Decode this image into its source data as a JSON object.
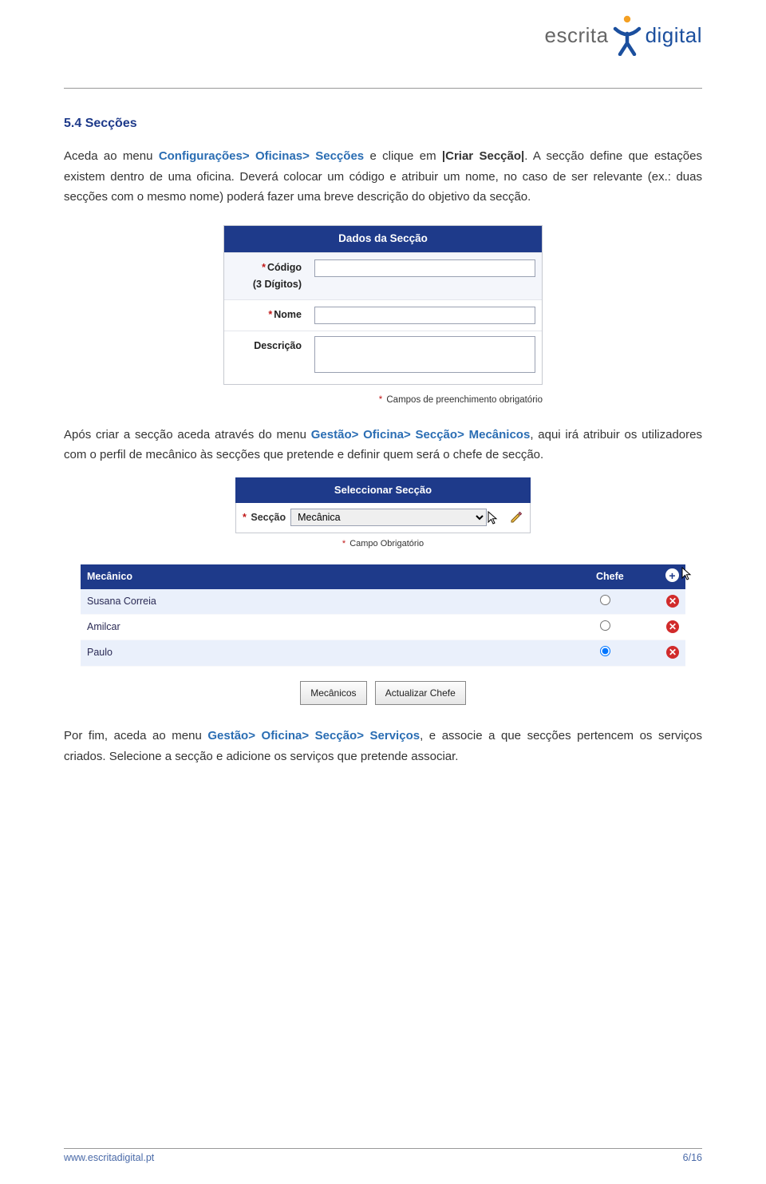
{
  "logo": {
    "word1": "escrita",
    "word2": "digital"
  },
  "heading": "5.4  Secções",
  "para1_pre": "Aceda ao menu ",
  "para1_link": "Configurações> Oficinas> Secções",
  "para1_mid": " e clique em ",
  "para1_bold": "|Criar Secção|",
  "para1_post": ". A secção define que estações existem dentro de uma oficina. Deverá colocar um código e atribuir um nome, no caso de ser relevante (ex.: duas secções com o mesmo nome) poderá fazer uma breve descrição do objetivo da secção.",
  "form1": {
    "title": "Dados da Secção",
    "codigo_label": "Código",
    "codigo_sub": "(3 Dígitos)",
    "nome_label": "Nome",
    "desc_label": "Descrição",
    "note": "Campos de preenchimento obrigatório"
  },
  "para2_pre": "Após criar a secção aceda através do menu ",
  "para2_link": "Gestão> Oficina> Secção> Mecânicos",
  "para2_post": ", aqui irá atribuir os utilizadores com o perfil de mecânico às secções que pretende e definir quem será o chefe de secção.",
  "sel": {
    "title": "Seleccionar Secção",
    "label": "Secção",
    "value": "Mecânica",
    "note": "Campo Obrigatório"
  },
  "mech": {
    "h1": "Mecânico",
    "h2": "Chefe",
    "rows": [
      {
        "name": "Susana Correia",
        "chief": false
      },
      {
        "name": "Amilcar",
        "chief": false
      },
      {
        "name": "Paulo",
        "chief": true
      }
    ]
  },
  "buttons": {
    "b1": "Mecânicos",
    "b2": "Actualizar Chefe"
  },
  "para3_pre": "Por fim, aceda ao menu ",
  "para3_link": "Gestão> Oficina> Secção> Serviços",
  "para3_post": ", e associe a que secções pertencem os serviços criados. Selecione a secção e adicione os serviços que pretende associar.",
  "footer": {
    "site": "www.escritadigital.pt",
    "page": "6/16"
  }
}
